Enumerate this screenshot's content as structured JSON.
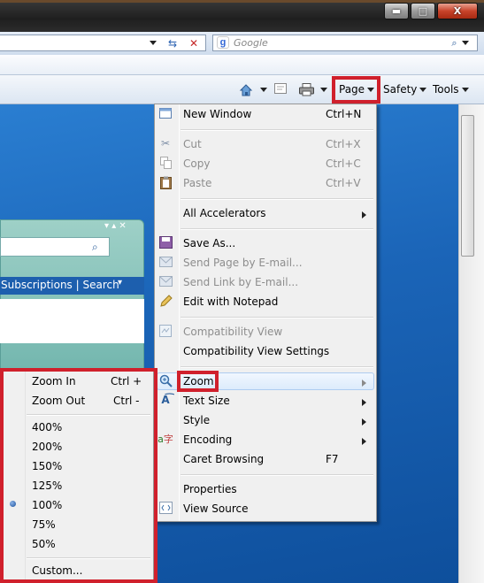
{
  "window": {
    "min_label": "▬",
    "max_label": "□",
    "close_label": "X"
  },
  "search": {
    "placeholder": "Google",
    "engine_icon": "google-g-icon"
  },
  "commandbar": {
    "home_icon": "home-icon",
    "feeds_icon": "feeds-icon",
    "print_icon": "print-icon",
    "page_label": "Page",
    "safety_label": "Safety",
    "tools_label": "Tools"
  },
  "page_widget": {
    "links": "Subscriptions | Search"
  },
  "page_menu": {
    "items": [
      {
        "label": "New Window",
        "shortcut": "Ctrl+N",
        "enabled": true,
        "icon": "new-window-icon"
      },
      {
        "label": "Cut",
        "shortcut": "Ctrl+X",
        "enabled": false,
        "icon": "scissors-icon"
      },
      {
        "label": "Copy",
        "shortcut": "Ctrl+C",
        "enabled": false,
        "icon": "copy-icon"
      },
      {
        "label": "Paste",
        "shortcut": "Ctrl+V",
        "enabled": false,
        "icon": "paste-icon"
      },
      {
        "label": "All Accelerators",
        "submenu": true,
        "enabled": true
      },
      {
        "label": "Save As...",
        "enabled": true,
        "icon": "save-icon"
      },
      {
        "label": "Send Page by E-mail...",
        "enabled": false,
        "icon": "mail-page-icon"
      },
      {
        "label": "Send Link by E-mail...",
        "enabled": false,
        "icon": "mail-link-icon"
      },
      {
        "label": "Edit with Notepad",
        "enabled": true,
        "icon": "pencil-icon"
      },
      {
        "label": "Compatibility View",
        "enabled": false,
        "icon": "compat-icon"
      },
      {
        "label": "Compatibility View Settings",
        "enabled": true
      },
      {
        "label": "Zoom",
        "submenu": true,
        "enabled": true,
        "highlighted": true,
        "icon": "zoom-icon"
      },
      {
        "label": "Text Size",
        "submenu": true,
        "enabled": true,
        "icon": "text-size-icon"
      },
      {
        "label": "Style",
        "submenu": true,
        "enabled": true
      },
      {
        "label": "Encoding",
        "submenu": true,
        "enabled": true,
        "icon": "encoding-icon"
      },
      {
        "label": "Caret Browsing",
        "shortcut": "F7",
        "enabled": true
      },
      {
        "label": "Properties",
        "enabled": true
      },
      {
        "label": "View Source",
        "enabled": true,
        "icon": "view-source-icon"
      }
    ]
  },
  "zoom_menu": {
    "zoom_in": {
      "label": "Zoom In",
      "shortcut": "Ctrl +"
    },
    "zoom_out": {
      "label": "Zoom Out",
      "shortcut": "Ctrl -"
    },
    "levels": [
      "400%",
      "200%",
      "150%",
      "125%",
      "100%",
      "75%",
      "50%"
    ],
    "selected": "100%",
    "custom": "Custom..."
  },
  "colors": {
    "highlight_border": "#d0202c",
    "menu_bg": "#f0f0f0"
  }
}
